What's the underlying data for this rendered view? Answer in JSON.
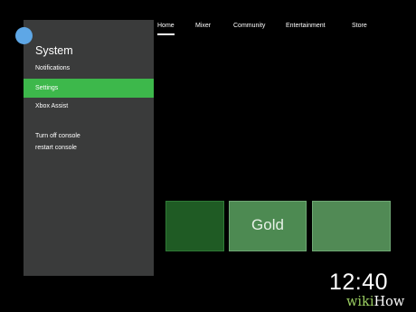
{
  "guide": {
    "title": "System",
    "items": [
      {
        "label": "Notifications"
      },
      {
        "label": "Settings",
        "selected": true
      },
      {
        "label": "Xbox Assist"
      },
      {
        "label": "Turn off console"
      },
      {
        "label": "restart console"
      }
    ]
  },
  "nav": {
    "tabs": [
      {
        "label": "Home",
        "active": true
      },
      {
        "label": "Mixer"
      },
      {
        "label": "Community"
      },
      {
        "label": "Entertainment"
      },
      {
        "label": "Store"
      }
    ]
  },
  "tiles": [
    {
      "label": ""
    },
    {
      "label": "Gold"
    },
    {
      "label": ""
    }
  ],
  "clock": "12:40",
  "watermark": {
    "part1": "wiki",
    "part2": "How"
  },
  "colors": {
    "accent": "#3db84b",
    "panel": "#3a3b3b",
    "avatar": "#5ea7e6",
    "background": "#000000"
  }
}
